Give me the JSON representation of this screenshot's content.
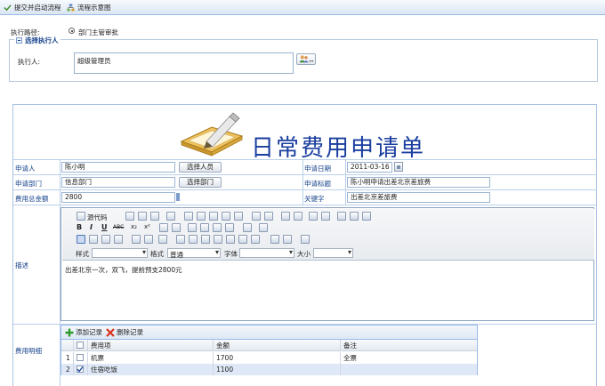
{
  "toolbar": {
    "submit_label": "提交并启动流程",
    "flowchart_label": "流程示意图"
  },
  "route": {
    "label": "执行路径:",
    "option": "部门主管审批"
  },
  "executor_section": {
    "legend": "选择执行人",
    "label": "执行人:",
    "value": "超级管理员"
  },
  "form": {
    "title": "日常费用申请单",
    "applicant": {
      "label": "申请人",
      "value": "陈小明",
      "button": "选择人员"
    },
    "apply_date": {
      "label": "申请日期",
      "value": "2011-03-16"
    },
    "department": {
      "label": "申请部门",
      "value": "信息部门",
      "button": "选择部门"
    },
    "apply_title": {
      "label": "申请标题",
      "value": "陈小明申请出差北京差旅费"
    },
    "total": {
      "label": "费用总金额",
      "value": "2800"
    },
    "keyword": {
      "label": "关键字",
      "value": "出差北京差旅费"
    },
    "description": {
      "label": "描述",
      "source_label": "源代码",
      "style_label": "样式",
      "format_label": "格式",
      "format_value": "普通",
      "font_label": "字体",
      "size_label": "大小",
      "content": "出差北京一次，双飞，提前预支2800元"
    },
    "details": {
      "label": "费用明细",
      "add_label": "添加记录",
      "delete_label": "删除记录",
      "columns": [
        "费用项",
        "金额",
        "备注"
      ],
      "rows": [
        {
          "no": "1",
          "item": "机票",
          "amount": "1700",
          "note": "全票",
          "checked": false
        },
        {
          "no": "2",
          "item": "住宿吃饭",
          "amount": "1100",
          "note": "",
          "checked": true
        }
      ]
    }
  },
  "colors": {
    "accent": "#15428b",
    "title": "#1b3fa0",
    "border": "#99bbe8"
  }
}
